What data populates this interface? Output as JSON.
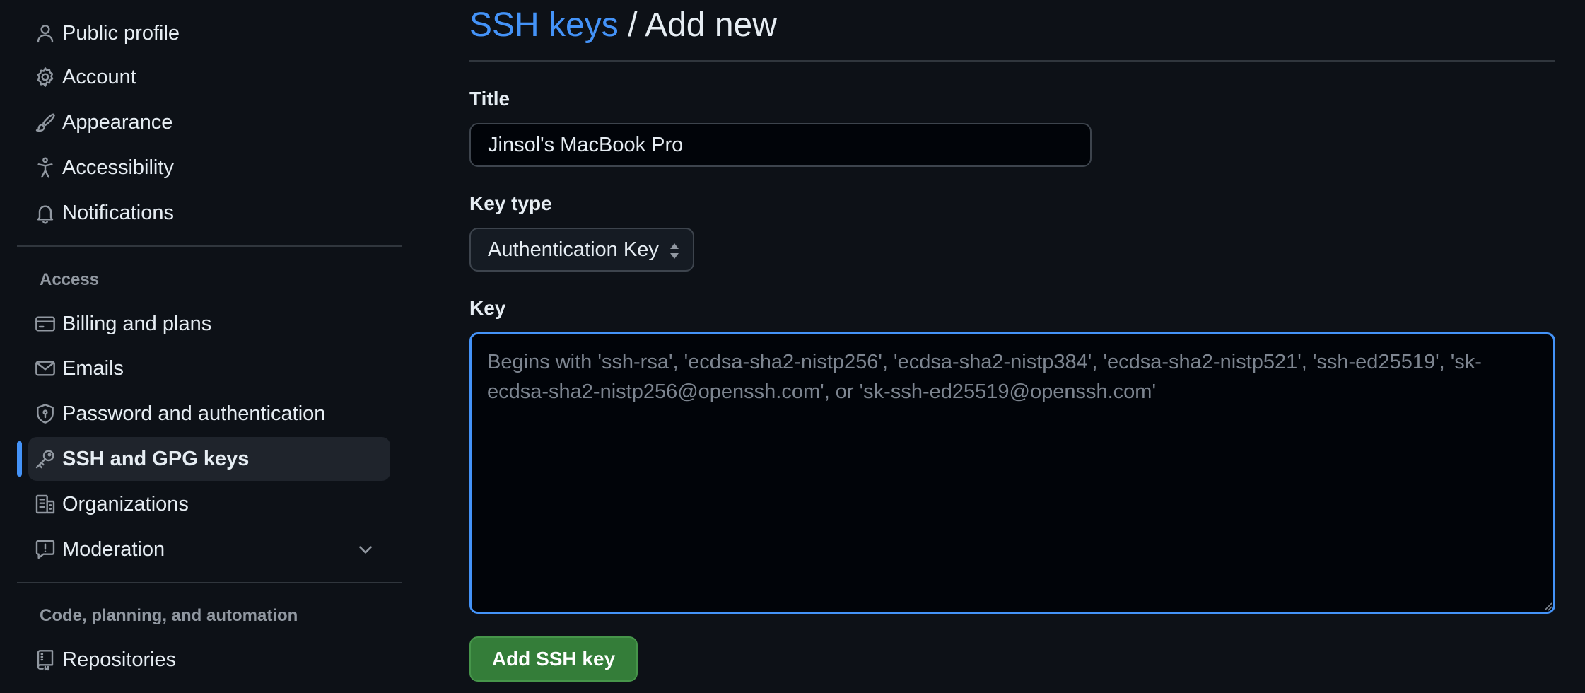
{
  "sidebar": {
    "items_top": [
      {
        "label": "Public profile",
        "icon": "person-icon"
      },
      {
        "label": "Account",
        "icon": "gear-icon"
      },
      {
        "label": "Appearance",
        "icon": "paintbrush-icon"
      },
      {
        "label": "Accessibility",
        "icon": "accessibility-icon"
      },
      {
        "label": "Notifications",
        "icon": "bell-icon"
      }
    ],
    "access_heading": "Access",
    "items_access": [
      {
        "label": "Billing and plans",
        "icon": "credit-card-icon"
      },
      {
        "label": "Emails",
        "icon": "mail-icon"
      },
      {
        "label": "Password and authentication",
        "icon": "shield-lock-icon"
      },
      {
        "label": "SSH and GPG keys",
        "icon": "key-icon",
        "active": true
      },
      {
        "label": "Organizations",
        "icon": "organization-icon"
      },
      {
        "label": "Moderation",
        "icon": "report-icon",
        "expandable": true
      }
    ],
    "code_heading": "Code, planning, and automation",
    "items_code": [
      {
        "label": "Repositories",
        "icon": "repo-icon"
      }
    ],
    "active_accent_color": "#4493f8"
  },
  "main": {
    "breadcrumb_link": "SSH keys",
    "breadcrumb_separator": " / ",
    "page_title": "Add new",
    "title_label": "Title",
    "title_value": "Jinsol's MacBook Pro",
    "key_type_label": "Key type",
    "key_type_value": "Authentication Key",
    "key_label": "Key",
    "key_value": "",
    "key_placeholder": "Begins with 'ssh-rsa', 'ecdsa-sha2-nistp256', 'ecdsa-sha2-nistp384', 'ecdsa-sha2-nistp521', 'ssh-ed25519', 'sk-ecdsa-sha2-nistp256@openssh.com', or 'sk-ssh-ed25519@openssh.com'",
    "submit_label": "Add SSH key",
    "submit_color": "#347d39",
    "link_color": "#4493f8"
  }
}
